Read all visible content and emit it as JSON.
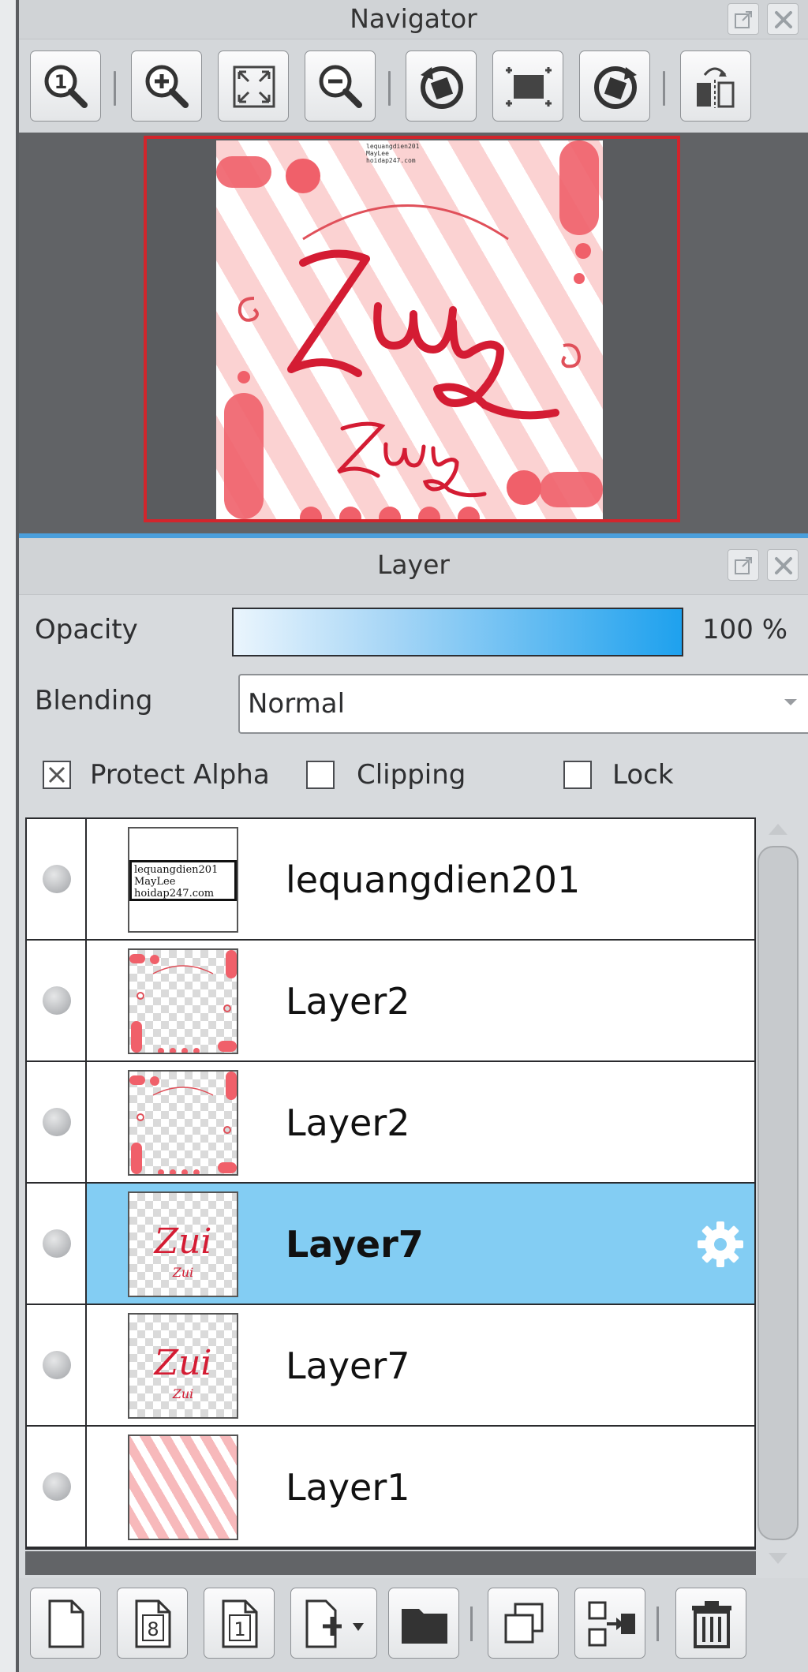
{
  "navigator": {
    "title": "Navigator",
    "toolbar": [
      "zoom-actual-icon",
      "zoom-in-icon",
      "fit-screen-icon",
      "zoom-out-icon",
      "rotate-left-icon",
      "reset-view-icon",
      "rotate-right-icon",
      "flip-horizontal-icon"
    ],
    "preview": {
      "credit_lines": [
        "lequangdien201",
        "MayLee",
        "hoidap247.com"
      ],
      "big_text": "Zui",
      "small_text": "Zui",
      "accent": "#e8343f"
    }
  },
  "layer_panel": {
    "title": "Layer",
    "opacity_label": "Opacity",
    "opacity_value": "100 %",
    "blending_label": "Blending",
    "blending_value": "Normal",
    "protect_alpha_label": "Protect Alpha",
    "protect_alpha_checked": true,
    "clipping_label": "Clipping",
    "clipping_checked": false,
    "lock_label": "Lock",
    "lock_checked": false,
    "layers": [
      {
        "name": "lequangdien201",
        "thumb": "text",
        "thumb_lines": [
          "lequangdien201",
          "MayLee",
          "hoidap247.com"
        ],
        "selected": false
      },
      {
        "name": "Layer2",
        "thumb": "decor",
        "selected": false
      },
      {
        "name": "Layer2",
        "thumb": "decor",
        "selected": false
      },
      {
        "name": "Layer7",
        "thumb": "script",
        "thumb_text": "Zui",
        "selected": true
      },
      {
        "name": "Layer7",
        "thumb": "script",
        "thumb_text": "Zui",
        "selected": false
      },
      {
        "name": "Layer1",
        "thumb": "stripes",
        "selected": false
      }
    ],
    "bottom_toolbar": [
      "new-layer-icon",
      "new-8bit-layer-icon",
      "new-1bit-layer-icon",
      "add-layer-menu-icon",
      "folder-icon",
      "duplicate-layer-icon",
      "merge-layer-icon",
      "delete-layer-icon"
    ],
    "bottom_labels": {
      "eight": "8",
      "one": "1"
    },
    "selected_color": "#83cdf3"
  }
}
